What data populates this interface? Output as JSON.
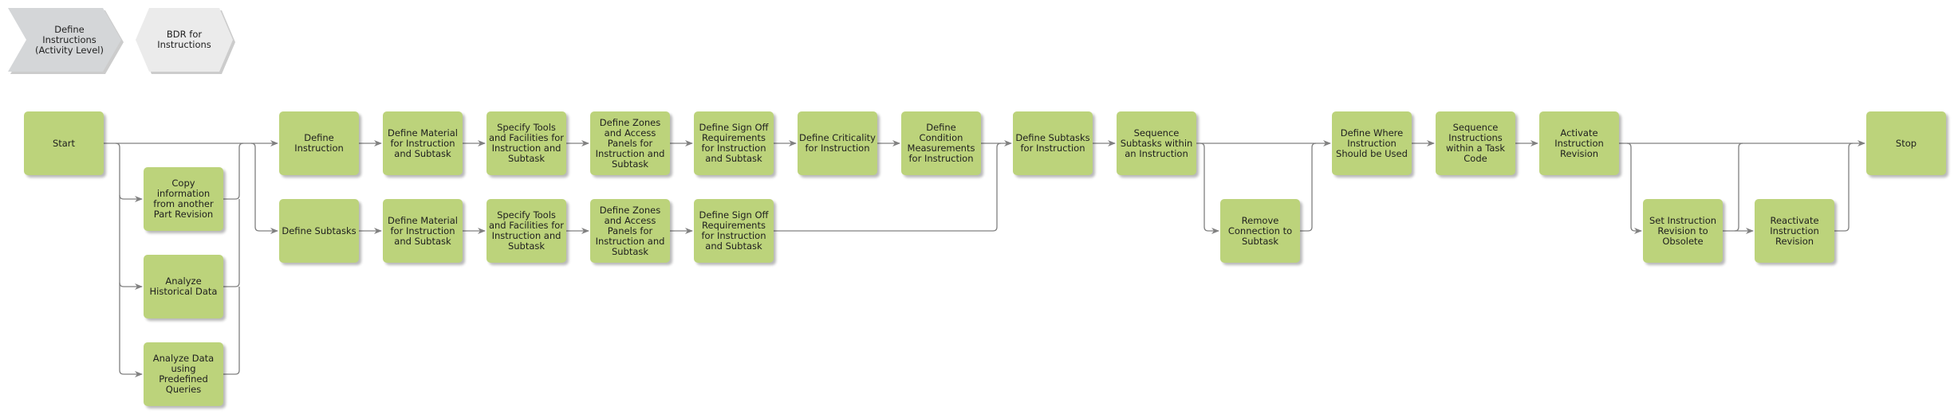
{
  "phases": [
    {
      "id": "p1",
      "label": "Define Instructions (Activity Level)",
      "shape": "chevron",
      "fill": "#d4d6d8"
    },
    {
      "id": "p2",
      "label": "BDR for Instructions",
      "shape": "hexagon",
      "fill": "#ebebeb"
    }
  ],
  "colors": {
    "activity_fill": "#bcd37b",
    "connector": "#808080",
    "text": "#1e1e1e"
  },
  "nodes": [
    {
      "id": "start",
      "label": "Start"
    },
    {
      "id": "copy",
      "label": "Copy information from another Part Revision"
    },
    {
      "id": "hist",
      "label": "Analyze Historical Data"
    },
    {
      "id": "query",
      "label": "Analyze Data using Predefined Queries"
    },
    {
      "id": "definstr",
      "label": "Define Instruction"
    },
    {
      "id": "mat1",
      "label": "Define Material for Instruction and Subtask"
    },
    {
      "id": "tools1",
      "label": "Specify Tools and Facilities for Instruction and Subtask"
    },
    {
      "id": "zones1",
      "label": "Define Zones and Access Panels for Instruction and Subtask"
    },
    {
      "id": "sign1",
      "label": "Define Sign Off Requirements for Instruction and Subtask"
    },
    {
      "id": "crit",
      "label": "Define Criticality for Instruction"
    },
    {
      "id": "cond",
      "label": "Define Condition Measurements for Instruction"
    },
    {
      "id": "defsub",
      "label": "Define Subtasks"
    },
    {
      "id": "mat2",
      "label": "Define Material for Instruction and Subtask"
    },
    {
      "id": "tools2",
      "label": "Specify Tools and Facilities for Instruction and Subtask"
    },
    {
      "id": "zones2",
      "label": "Define Zones and Access Panels for Instruction and Subtask"
    },
    {
      "id": "sign2",
      "label": "Define Sign Off Requirements for Instruction and Subtask"
    },
    {
      "id": "subinstr",
      "label": "Define Subtasks for Instruction"
    },
    {
      "id": "seqsub",
      "label": "Sequence Subtasks within an Instruction"
    },
    {
      "id": "remove",
      "label": "Remove Connection to Subtask"
    },
    {
      "id": "where",
      "label": "Define Where Instruction Should be Used"
    },
    {
      "id": "seqinstr",
      "label": "Sequence Instructions within a Task Code"
    },
    {
      "id": "activate",
      "label": "Activate Instruction Revision"
    },
    {
      "id": "obsolete",
      "label": "Set Instruction Revision to Obsolete"
    },
    {
      "id": "reactivate",
      "label": "Reactivate Instruction Revision"
    },
    {
      "id": "stop",
      "label": "Stop"
    }
  ]
}
